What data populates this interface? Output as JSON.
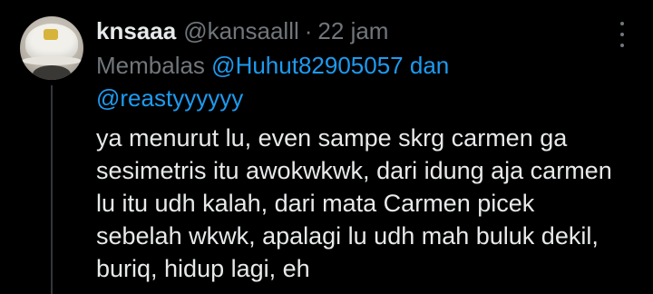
{
  "tweet": {
    "display_name": "knsaaa",
    "handle": "@kansaalll",
    "separator": "·",
    "timestamp": "22 jam",
    "reply_prefix": "Membalas",
    "mention_1": "@Huhut82905057",
    "reply_conjunction": "dan",
    "mention_2": "@reastyyyyyy",
    "body_lines": [
      "ya menurut lu, even sampe skrg carmen ga",
      "sesimetris itu awokwkwk, dari idung aja carmen",
      "lu itu udh kalah, dari mata Carmen picek",
      "sebelah wkwk, apalagi lu udh mah buluk dekil,",
      "buriq, hidup lagi, eh"
    ]
  },
  "icons": {
    "more": "more-vertical-icon",
    "avatar": "user-avatar"
  },
  "colors": {
    "background": "#000000",
    "primary_text": "#e7e9ea",
    "secondary_text": "#71767b",
    "link": "#1d9bf0",
    "thread_line": "#333639"
  }
}
